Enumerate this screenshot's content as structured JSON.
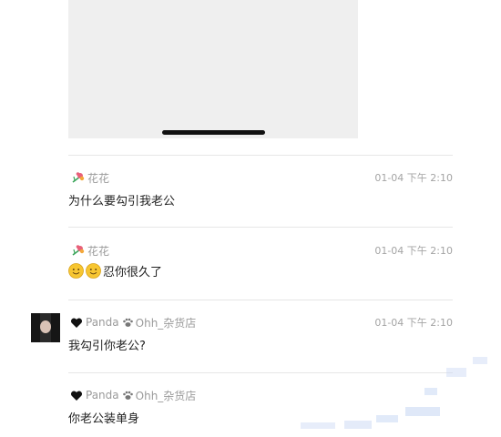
{
  "comments": [
    {
      "user_name": "花花",
      "user_icon": "flower-icon",
      "time": "01-04 下午 2:10",
      "text": "为什么要勾引我老公"
    },
    {
      "user_name": "花花",
      "user_icon": "flower-icon",
      "time": "01-04 下午 2:10",
      "text_suffix": "忍你很久了",
      "leading_emoji": [
        "smile-emoji-icon",
        "smile-emoji-icon"
      ]
    },
    {
      "user_name_a": "Panda",
      "user_name_b": "Ohh_杂货店",
      "user_icon": "heart-icon",
      "separator_icon": "paw-icon",
      "time": "01-04 下午 2:10",
      "text": "我勾引你老公?",
      "has_avatar": true
    },
    {
      "user_name_a": "Panda",
      "user_name_b": "Ohh_杂货店",
      "user_icon": "heart-icon",
      "separator_icon": "paw-icon",
      "text": "你老公装单身"
    }
  ],
  "colors": {
    "media_background": "#efefef",
    "name_text": "#9a9a9a",
    "body_text": "#222222",
    "divider": "#e6e6e6"
  }
}
